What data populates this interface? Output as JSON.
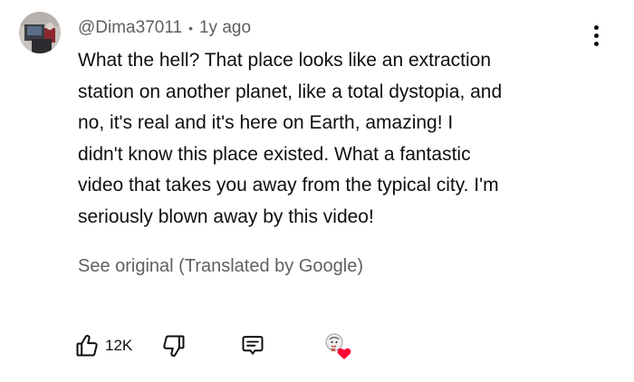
{
  "comment": {
    "author": "@Dima37011",
    "separator": "•",
    "time_ago": "1y ago",
    "text_lines": [
      "What the hell? That place looks like an extraction",
      "station on another planet, like a total dystopia, and",
      "no, it's real and it's here on Earth, amazing! I",
      "didn't know this place existed. What a fantastic",
      "video that takes you away from the typical city. I'm",
      "seriously blown away by this video!"
    ],
    "translate_label": "See original (Translated by Google)",
    "like_count": "12K"
  },
  "icons": {
    "avatar": "user-avatar",
    "more": "more-vertical-icon",
    "like": "thumbs-up-icon",
    "dislike": "thumbs-down-icon",
    "reply": "reply-comment-icon",
    "creator_heart": "creator-heart-icon"
  },
  "colors": {
    "text_primary": "#0f0f0f",
    "text_secondary": "#606060",
    "heart": "#ff0033",
    "background": "#ffffff"
  }
}
